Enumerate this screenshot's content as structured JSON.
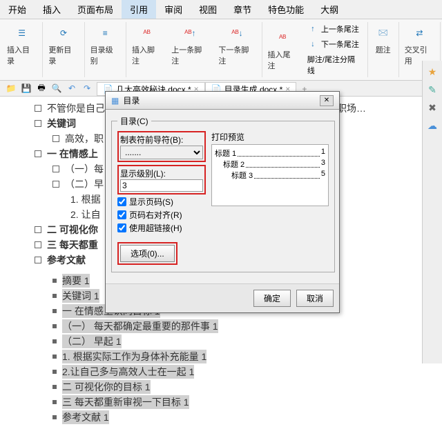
{
  "tabs": [
    "开始",
    "插入",
    "页面布局",
    "引用",
    "审阅",
    "视图",
    "章节",
    "特色功能",
    "大纲"
  ],
  "active_tab": "引用",
  "ribbon": {
    "insert_toc": "插入目录",
    "update_toc": "更新目录",
    "toc_level_dd": "目录级别",
    "insert_footnote": "插入脚注",
    "prev_footnote": "上一条脚注",
    "next_footnote": "下一条脚注",
    "insert_endnote": "插入尾注",
    "prev_endnote": "上一条尾注",
    "next_endnote": "下一条尾注",
    "fn_en_sep": "脚注/尾注分隔线",
    "caption": "题注",
    "cross_ref": "交叉引用"
  },
  "doctabs": {
    "a": "几大高效秘诀.docx *",
    "b": "目录生成.docx *"
  },
  "content": {
    "l1": "不管你是自己创业当老板还是给别人打工，做一个高效的人都是走向职场…",
    "l2": "关键词",
    "l3": "高效，职",
    "l4": "一  在情感上",
    "l5": "（一）每",
    "l6": "（二）早",
    "l7": "1. 根据",
    "l8": "2. 让自",
    "l9": "二  可视化你",
    "l10": "三  每天都重",
    "l11": "参考文献",
    "t1": "摘要  1",
    "t2": "关键词  1",
    "t3": "一 在情感上认同目标    1",
    "t4": "（一） 每天都确定最重要的那件事    1",
    "t5": "（二） 早起    1",
    "t6": "1. 根据实际工作为身体补充能量    1",
    "t7": "2.让自己多与高效人士在一起    1",
    "t8": "二  可视化你的目标    1",
    "t9": "三  每天都重新审视一下目标    1",
    "t10": "参考文献   1"
  },
  "dialog": {
    "title": "目录",
    "group_label": "目录(C)",
    "tab_leader_label": "制表符前导符(B):",
    "tab_leader_value": ".......",
    "levels_label": "显示级别(L):",
    "levels_value": "3",
    "show_page": "显示页码(S)",
    "align_right": "页码右对齐(R)",
    "use_hyperlink": "使用超链接(H)",
    "options_btn": "选项(0)...",
    "preview_label": "打印预览",
    "preview": {
      "r1": {
        "label": "标题 1",
        "page": "1"
      },
      "r2": {
        "label": "标题 2",
        "page": "3"
      },
      "r3": {
        "label": "标题 3",
        "page": "5"
      }
    },
    "ok": "确定",
    "cancel": "取消"
  }
}
